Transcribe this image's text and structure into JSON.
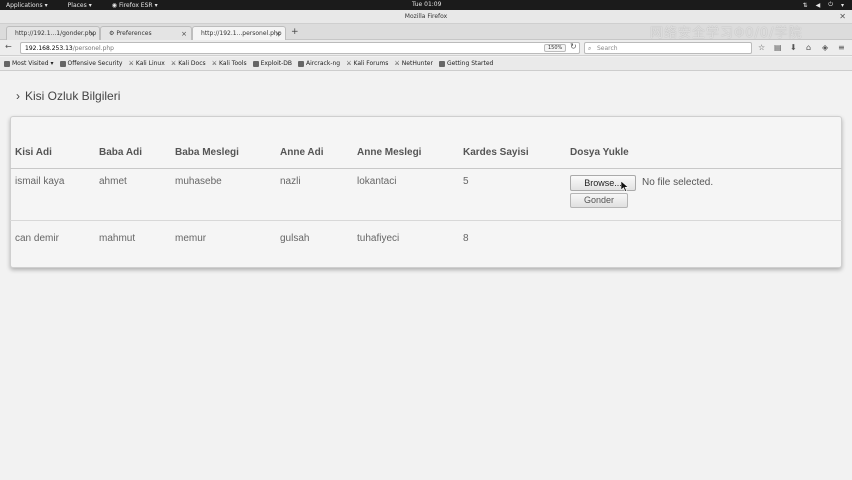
{
  "topbar": {
    "applications": "Applications",
    "places": "Places",
    "app_name": "Firefox ESR",
    "clock": "Tue 01:09"
  },
  "window": {
    "title": "Mozilla Firefox"
  },
  "tabs": [
    {
      "label": "http://192.1...1/gonder.php"
    },
    {
      "label": "Preferences"
    },
    {
      "label": "http://192.1...personel.php"
    }
  ],
  "nav": {
    "url_host": "192.168.253.13",
    "url_path": "/personel.php",
    "zoom": "150%",
    "search_placeholder": "Search"
  },
  "bookmarks": [
    "Most Visited",
    "Offensive Security",
    "Kali Linux",
    "Kali Docs",
    "Kali Tools",
    "Exploit-DB",
    "Aircrack-ng",
    "Kali Forums",
    "NetHunter",
    "Getting Started"
  ],
  "page": {
    "title": "Kisi Ozluk Bilgileri",
    "headers": [
      "Kisi Adi",
      "Baba Adi",
      "Baba Meslegi",
      "Anne Adi",
      "Anne Meslegi",
      "Kardes Sayisi",
      "Dosya Yukle"
    ],
    "rows": [
      [
        "ismail kaya",
        "ahmet",
        "muhasebe",
        "nazli",
        "lokantaci",
        "5"
      ],
      [
        "can demir",
        "mahmut",
        "memur",
        "gulsah",
        "tuhafiyeci",
        "8"
      ]
    ],
    "browse_label": "Browse...",
    "file_status": "No file selected.",
    "submit_label": "Gonder"
  },
  "watermark": "网络安全学习Φ0/0/学院"
}
